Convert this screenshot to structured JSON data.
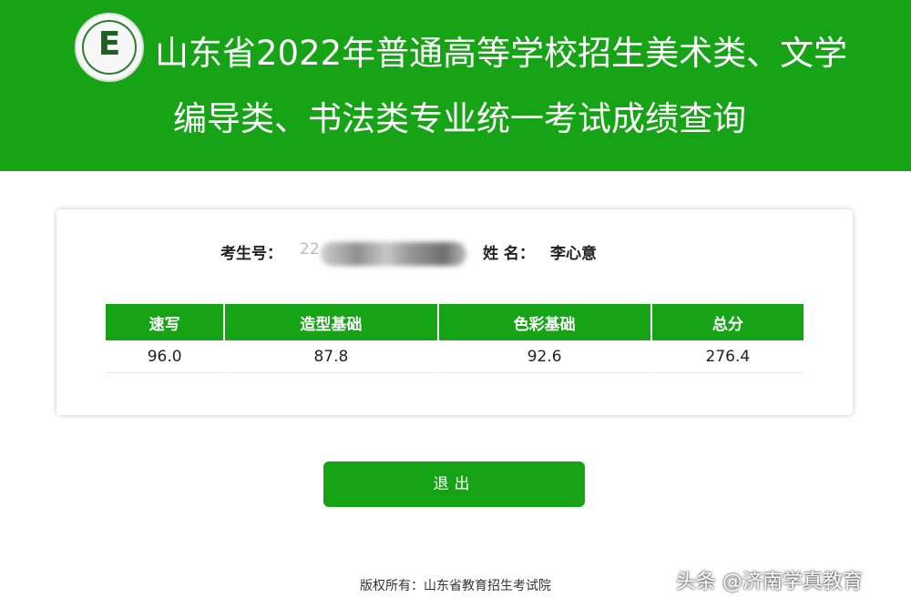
{
  "header": {
    "logo_letter": "E",
    "title_line1": "山东省2022年普通高等学校招生美术类、文学",
    "title_line2": "编导类、书法类专业统一考试成绩查询",
    "brand_color": "#16a316"
  },
  "candidate": {
    "exam_no_label": "考生号：",
    "exam_no_visible": "22",
    "name_label": "姓 名：",
    "name_value": "李心意"
  },
  "scores": {
    "headers": [
      "速写",
      "造型基础",
      "色彩基础",
      "总分"
    ],
    "values": [
      "96.0",
      "87.8",
      "92.6",
      "276.4"
    ]
  },
  "actions": {
    "logout_label": "退出"
  },
  "footer": {
    "copyright": "版权所有：山东省教育招生考试院"
  },
  "watermark": "头条 @济南学真教育"
}
